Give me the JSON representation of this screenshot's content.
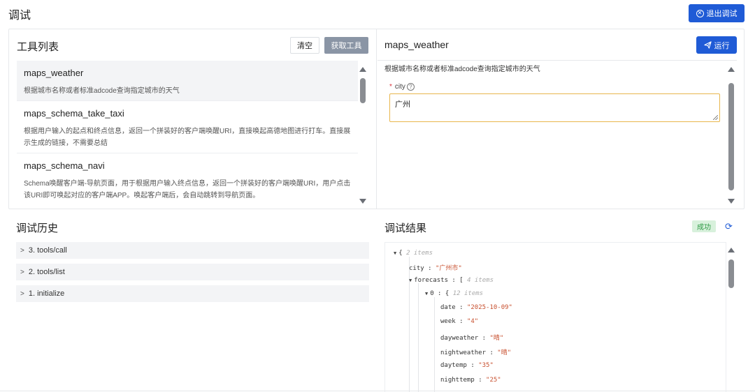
{
  "header": {
    "title": "调试",
    "exit_label": "退出调试"
  },
  "tools": {
    "title": "工具列表",
    "clear_label": "清空",
    "fetch_label": "获取工具",
    "items": [
      {
        "name": "maps_weather",
        "desc": "根据城市名称或者标准adcode查询指定城市的天气"
      },
      {
        "name": "maps_schema_take_taxi",
        "desc": "根据用户输入的起点和终点信息，返回一个拼装好的客户端唤醒URI，直接唤起高德地图进行打车。直接展示生成的链接，不需要总结"
      },
      {
        "name": "maps_schema_navi",
        "desc": "Schema唤醒客户端-导航页面，用于根据用户输入终点信息，返回一个拼装好的客户端唤醒URI，用户点击该URI即可唤起对应的客户端APP。唤起客户端后，会自动跳转到导航页面。"
      }
    ]
  },
  "detail": {
    "name": "maps_weather",
    "run_label": "运行",
    "desc": "根据城市名称或者标准adcode查询指定城市的天气",
    "param_label": "city",
    "param_required": "*",
    "param_value": "广州"
  },
  "history": {
    "title": "调试历史",
    "items": [
      "3. tools/call",
      "2. tools/list",
      "1. initialize"
    ]
  },
  "result": {
    "title": "调试结果",
    "status": "成功",
    "root_meta": "2 items",
    "city_key": "city",
    "city_val": "\"广州市\"",
    "forecasts_key": "forecasts",
    "forecasts_meta": "4 items",
    "item0_key": "0",
    "item0_meta": "12 items",
    "fields": [
      {
        "k": "date",
        "v": "\"2025-10-09\""
      },
      {
        "k": "week",
        "v": "\"4\""
      },
      {
        "k": "dayweather",
        "v": "\"晴\""
      },
      {
        "k": "nightweather",
        "v": "\"晴\""
      },
      {
        "k": "daytemp",
        "v": "\"35\""
      },
      {
        "k": "nighttemp",
        "v": "\"25\""
      }
    ]
  }
}
